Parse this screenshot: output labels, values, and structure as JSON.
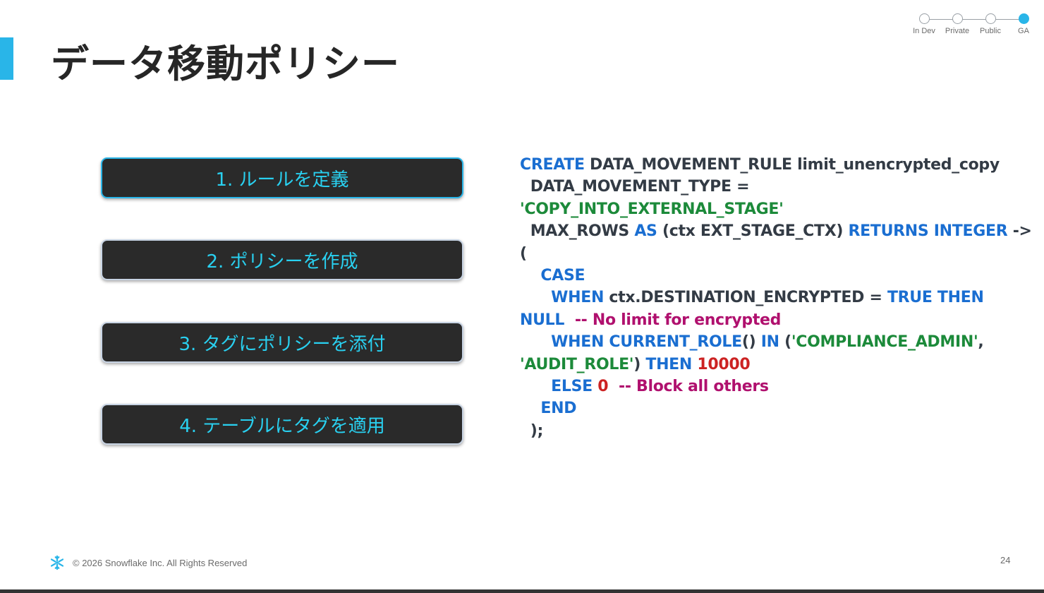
{
  "title": "データ移動ポリシー",
  "stages": [
    {
      "label": "In Dev",
      "active": false
    },
    {
      "label": "Private",
      "active": false
    },
    {
      "label": "Public",
      "active": false
    },
    {
      "label": "GA",
      "active": true
    }
  ],
  "steps": [
    {
      "label": "1. ルールを定義",
      "active": true
    },
    {
      "label": "2. ポリシーを作成",
      "active": false
    },
    {
      "label": "3. タグにポリシーを添付",
      "active": false
    },
    {
      "label": "4. テーブルにタグを適用",
      "active": false
    }
  ],
  "code": {
    "l1_kw": "CREATE",
    "l1_rest": " DATA_MOVEMENT_RULE limit_unencrypted_copy",
    "l2": "  DATA_MOVEMENT_TYPE =",
    "l3_str": "'COPY_INTO_EXTERNAL_STAGE'",
    "l4_a": "  MAX_ROWS ",
    "l4_kw1": "AS",
    "l4_b": " (ctx EXT_STAGE_CTX) ",
    "l4_kw2": "RETURNS INTEGER",
    "l4_c": " ->",
    "l5": "(",
    "l6_kw": "    CASE",
    "l7_kw1": "      WHEN",
    "l7_b": " ctx.DESTINATION_ENCRYPTED = ",
    "l7_kw2": "TRUE THEN",
    "l8_kw": "NULL",
    "l8_cmt": "  -- No limit for encrypted",
    "l9_kw1": "      WHEN CURRENT_ROLE",
    "l9_b": "() ",
    "l9_kw2": "IN",
    "l9_c": " (",
    "l9_str": "'COMPLIANCE_ADMIN'",
    "l9_d": ",",
    "l10_str": "'AUDIT_ROLE'",
    "l10_b": ") ",
    "l10_kw": "THEN",
    "l10_num": " 10000",
    "l11_kw": "      ELSE",
    "l11_num": " 0",
    "l11_cmt": "  -- Block all others",
    "l12_kw": "    END",
    "l13": "  );"
  },
  "footer": {
    "copyright": "© 2026 Snowflake Inc. All Rights Reserved",
    "page_number": "24",
    "logo_icon": "snowflake-icon"
  },
  "colors": {
    "accent": "#29b5e8",
    "keyword": "#1a6ed1",
    "string": "#1c8a3a",
    "number": "#cc2222",
    "comment": "#b0106e",
    "step_text": "#29d0f0"
  }
}
